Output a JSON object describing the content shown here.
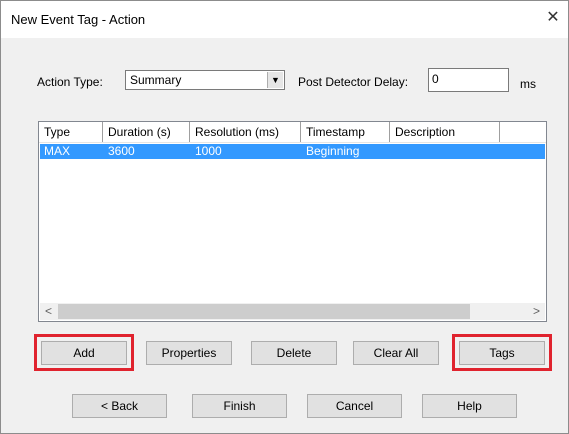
{
  "dialog": {
    "title": "New Event Tag - Action",
    "close_glyph": "✕"
  },
  "action": {
    "type_label": "Action Type:",
    "type_value": "Summary",
    "dropdown_glyph": "▼",
    "delay_label": "Post Detector Delay:",
    "delay_value": "0",
    "delay_unit": "ms"
  },
  "list": {
    "columns": [
      "Type",
      "Duration (s)",
      "Resolution (ms)",
      "Timestamp",
      "Description"
    ],
    "rows": [
      {
        "type": "MAX",
        "duration": "3600",
        "resolution": "1000",
        "timestamp": "Beginning",
        "description": "",
        "selected": true
      }
    ],
    "scroll_left_glyph": "<",
    "scroll_right_glyph": ">"
  },
  "buttons": {
    "add": "Add",
    "properties": "Properties",
    "delete": "Delete",
    "clear_all": "Clear All",
    "tags": "Tags",
    "back": "< Back",
    "finish": "Finish",
    "cancel": "Cancel",
    "help": "Help"
  },
  "colors": {
    "selection": "#3399ff",
    "highlight_box": "#e0232e"
  },
  "highlighted": [
    "add-button",
    "tags-button"
  ]
}
